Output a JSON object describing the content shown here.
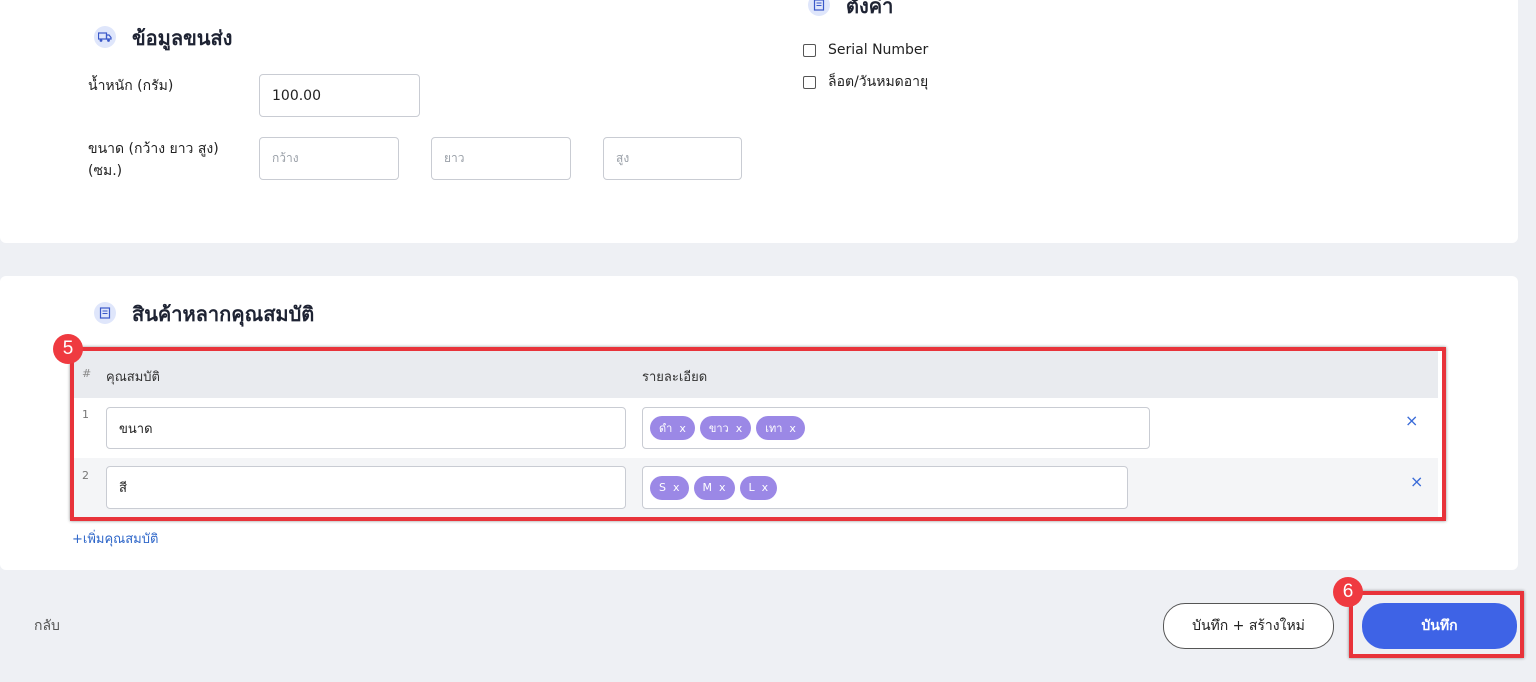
{
  "shipping": {
    "icon": "truck-icon",
    "title": "ข้อมูลขนส่ง",
    "weight_label": "น้ำหนัก (กรัม)",
    "weight_value": "100.00",
    "size_label_line1": "ขนาด (กว้าง ยาว สูง)",
    "size_label_line2": "(ซม.)",
    "width_placeholder": "กว้าง",
    "length_placeholder": "ยาว",
    "height_placeholder": "สูง"
  },
  "settings": {
    "icon": "document-icon",
    "title": "ตั้งค่า",
    "options": [
      "Serial Number",
      "ล็อต/วันหมดอายุ"
    ]
  },
  "variants": {
    "icon": "document-icon",
    "title": "สินค้าหลากคุณสมบัติ",
    "col_index": "#",
    "col_attribute": "คุณสมบัติ",
    "col_details": "รายละเอียด",
    "rows": [
      {
        "index": "1",
        "attribute": "ขนาด",
        "values": [
          "ดำ",
          "ขาว",
          "เทา"
        ]
      },
      {
        "index": "2",
        "attribute": "สี",
        "values": [
          "S",
          "M",
          "L"
        ]
      }
    ],
    "tag_remove": "x",
    "row_remove": "×",
    "add_link": "+เพิ่มคุณสมบัติ"
  },
  "footer": {
    "back_label": "กลับ",
    "save_new_label": "บันทึก + สร้างใหม่",
    "save_label": "บันทึก"
  },
  "annotations": [
    "5",
    "6"
  ],
  "colors": {
    "primary": "#3e63e6",
    "tag": "#9b88e6",
    "annotation": "#e8333a",
    "link": "#2f67c9"
  }
}
